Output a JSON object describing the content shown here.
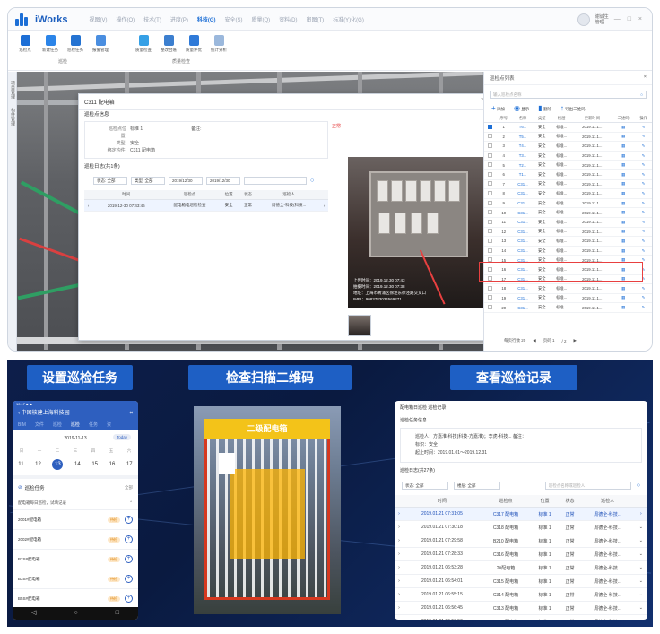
{
  "app": {
    "name": "iWorks",
    "menus": [
      "视图(V)",
      "操作(O)",
      "技术(T)",
      "进度(P)",
      "科技(G)",
      "安全(S)",
      "质量(Q)",
      "资料(D)",
      "审图(T)",
      "标准(Y)化(G)"
    ],
    "active_menu_index": 4,
    "user_name": "谢诚生",
    "user_role": "管理",
    "window_controls": "— □ ×"
  },
  "ribbon": {
    "groups": [
      {
        "label": "巡检",
        "buttons": [
          "巡检点",
          "新建任务",
          "巡检任务",
          "报警管理"
        ]
      },
      {
        "label": "质量检查",
        "buttons": [
          "质量检查",
          "整改台账",
          "质量评优",
          "统计分析"
        ]
      }
    ]
  },
  "left_tabs": [
    "项目管理",
    "构件管理"
  ],
  "dialog": {
    "title": "C311 配电箱",
    "close": "×",
    "section_info": "巡检点信息",
    "info": [
      {
        "k": "巡检点位置:",
        "v": "标准 1",
        "k2": "备注:",
        "v2": ""
      },
      {
        "k": "类型:",
        "v": "安全"
      },
      {
        "k": "绑定构件:",
        "v": "C311 配电箱"
      }
    ],
    "section_records": "巡检日志(共1条)",
    "abnormal_label": "正常",
    "filters": {
      "status": "状态: 全部",
      "type": "类型: 全部",
      "date_from": "2019/12/30",
      "date_to": "2019/12/30"
    },
    "table": {
      "headers": [
        "",
        "时间",
        "巡检点",
        "位置",
        "状态",
        "巡检人",
        ""
      ],
      "rows": [
        [
          "›",
          "2019-12-30 07:43:46",
          "配电箱电巡检检查",
          "安全",
          "正常",
          "周德全-科技(科技...",
          "›"
        ]
      ]
    },
    "photo_text": [
      "上传时间：2019.12.30 07:43",
      "拍摄时间：2019.12.30 07:38",
      "地址：上海市青浦区徐泾东徐泾路交叉口",
      "IMEI：9083783034569271"
    ]
  },
  "right_panel": {
    "title": "巡检点列表",
    "search_placeholder": "输入巡检点名称",
    "tools": [
      "添加",
      "显示",
      "删除",
      "导出二维码"
    ],
    "headers": [
      "",
      "序号",
      "名称",
      "类型",
      "楼层",
      "更新时间",
      "二维码",
      "操作"
    ],
    "rows": [
      [
        "1",
        "T6...",
        "安全",
        "标准...",
        "2019.11.1..."
      ],
      [
        "2",
        "T5...",
        "安全",
        "标准...",
        "2019.11.1..."
      ],
      [
        "3",
        "T4...",
        "安全",
        "标准...",
        "2019.11.1..."
      ],
      [
        "4",
        "T3...",
        "安全",
        "标准...",
        "2019.11.1..."
      ],
      [
        "5",
        "T2...",
        "安全",
        "标准...",
        "2019.11.1..."
      ],
      [
        "6",
        "T1...",
        "安全",
        "标准...",
        "2019.11.1..."
      ],
      [
        "7",
        "C31...",
        "安全",
        "标准...",
        "2019.11.1..."
      ],
      [
        "8",
        "C31...",
        "安全",
        "标准...",
        "2019.11.1..."
      ],
      [
        "9",
        "C31...",
        "安全",
        "标准...",
        "2019.11.1..."
      ],
      [
        "10",
        "C31...",
        "安全",
        "标准...",
        "2019.11.1..."
      ],
      [
        "11",
        "C31...",
        "安全",
        "标准...",
        "2019.11.1..."
      ],
      [
        "12",
        "C31...",
        "安全",
        "标准...",
        "2019.11.1..."
      ],
      [
        "13",
        "C31...",
        "安全",
        "标准...",
        "2019.11.1..."
      ],
      [
        "14",
        "C31...",
        "安全",
        "标准...",
        "2019.11.1..."
      ],
      [
        "15",
        "C31...",
        "安全",
        "标准...",
        "2019.11.1..."
      ],
      [
        "16",
        "C31...",
        "安全",
        "标准...",
        "2019.11.1..."
      ],
      [
        "17",
        "C31...",
        "安全",
        "标准...",
        "2019.11.1..."
      ],
      [
        "18",
        "C31...",
        "安全",
        "标准...",
        "2019.11.1..."
      ],
      [
        "19",
        "C31...",
        "安全",
        "标准...",
        "2019.11.1..."
      ],
      [
        "20",
        "C31...",
        "安全",
        "标准...",
        "2019.11.1..."
      ]
    ],
    "highlighted_row": 14,
    "footer": {
      "per_page": "每页行数 20",
      "page": "页码 1",
      "of": "/ 2"
    }
  },
  "bottom": {
    "banners": [
      "设置巡检任务",
      "检查扫描二维码",
      "查看巡检记录"
    ],
    "phone": {
      "status": "10:17 ■ ▲",
      "project": "中国核建上海科技园",
      "tabs": [
        "BIM",
        "文件",
        "巡检",
        "巡检",
        "任务",
        "资"
      ],
      "active_tab": 3,
      "date": "2019-11-13",
      "today": "Today",
      "weekdays": [
        "日",
        "一",
        "二",
        "三",
        "四",
        "五",
        "六"
      ],
      "days": [
        "11",
        "12",
        "13",
        "14",
        "15",
        "16",
        "17"
      ],
      "selected_day": 2,
      "section": "巡检任务",
      "section_right": "全部",
      "sub": "配电箱每日巡检，试填记录",
      "items": [
        "2001#配电箱",
        "2002#配电箱",
        "B2S#配电箱",
        "B3S#配电箱",
        "B5S#配电箱"
      ],
      "tag": "待检",
      "nav": [
        "◁",
        "○",
        "□"
      ]
    },
    "qr_sign": "二级配电箱",
    "record": {
      "title": "配电箱日巡检 巡检记录",
      "section_info": "巡检任务信息",
      "info": [
        "巡检人：方嘉淮-科技(科技-方嘉淮)；李虎-科技...   备注：",
        "标识：安全",
        "起止时间：2019.01.01～2019.12.31"
      ],
      "section_records": "巡检日志(共27条)",
      "filters": {
        "status": "状态: 全部",
        "type": "楼层: 全部",
        "search": "巡检点名称或巡检人"
      },
      "headers": [
        "",
        "时间",
        "巡检点",
        "位置",
        "状态",
        "巡检人",
        ""
      ],
      "rows": [
        [
          "2019.01.21 07:31:05",
          "C317 配电箱",
          "标准 1",
          "正常",
          "周德全-科技..."
        ],
        [
          "2019.01.21 07:30:18",
          "C318 配电箱",
          "标准 1",
          "正常",
          "周德全-科技..."
        ],
        [
          "2019.01.21 07:29:58",
          "B210 配电箱",
          "标准 1",
          "正常",
          "周德全-科技..."
        ],
        [
          "2019.01.21 07:28:33",
          "C316 配电箱",
          "标准 1",
          "正常",
          "周德全-科技..."
        ],
        [
          "2019.01.21 06:53:28",
          "2#配电箱",
          "标准 1",
          "正常",
          "周德全-科技..."
        ],
        [
          "2019.01.21 06:54:01",
          "C315 配电箱",
          "标准 1",
          "正常",
          "周德全-科技..."
        ],
        [
          "2019.01.21 06:55:15",
          "C314 配电箱",
          "标准 1",
          "正常",
          "周德全-科技..."
        ],
        [
          "2019.01.21 06:56:45",
          "C313 配电箱",
          "标准 1",
          "正常",
          "周德全-科技..."
        ],
        [
          "2019.01.21 06:57:50",
          "C312 配电箱",
          "标准 1",
          "正常",
          "周德全-科技..."
        ]
      ]
    }
  },
  "colors": {
    "accent": "#1d6fd6",
    "alert": "#e84040",
    "banner": "#1e5fc4",
    "ok": "#20a050"
  }
}
